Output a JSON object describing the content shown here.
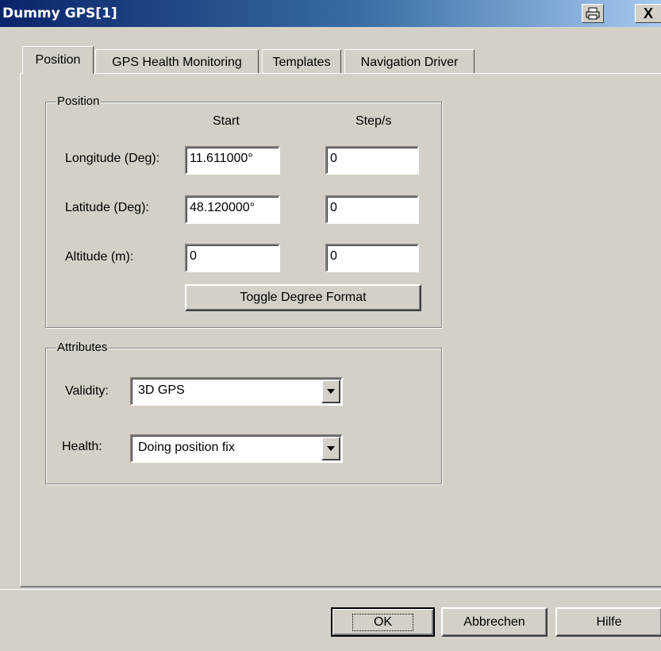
{
  "window": {
    "title": "Dummy GPS[1]",
    "extra_button_icon": "printer-icon",
    "close_label": "X"
  },
  "tabs": [
    {
      "label": "Position",
      "active": true
    },
    {
      "label": "GPS Health Monitoring",
      "active": false
    },
    {
      "label": "Templates",
      "active": false
    },
    {
      "label": "Navigation Driver",
      "active": false
    }
  ],
  "position": {
    "group_title": "Position",
    "col_start": "Start",
    "col_step": "Step/s",
    "rows": [
      {
        "label": "Longitude (Deg):",
        "start": "11.611000°",
        "step": "0"
      },
      {
        "label": "Latitude (Deg):",
        "start": "48.120000°",
        "step": "0"
      },
      {
        "label": "Altitude (m):",
        "start": "0",
        "step": "0"
      }
    ],
    "toggle_label": "Toggle Degree Format"
  },
  "attributes": {
    "group_title": "Attributes",
    "validity_label": "Validity:",
    "validity_value": "3D GPS",
    "health_label": "Health:",
    "health_value": "Doing position fix"
  },
  "buttons": {
    "ok": "OK",
    "cancel": "Abbrechen",
    "help": "Hilfe"
  },
  "colors": {
    "face": "#d4d0c8",
    "title_start": "#0a246a",
    "title_end": "#a6caf0"
  }
}
